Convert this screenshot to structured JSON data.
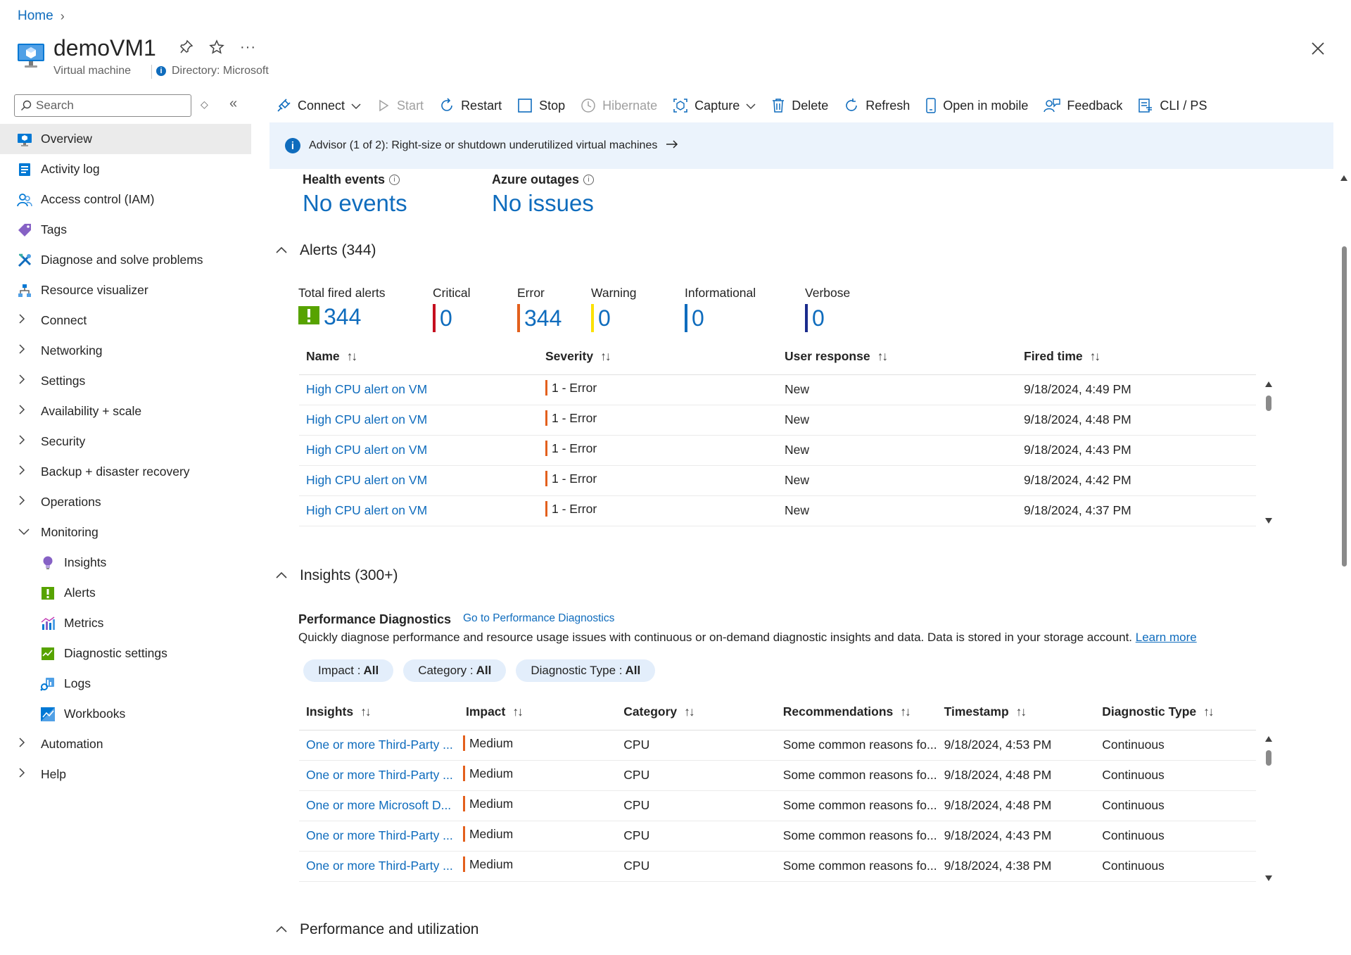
{
  "breadcrumb": {
    "home": "Home"
  },
  "header": {
    "title": "demoVM1",
    "subtitle": "Virtual machine",
    "directory": "Directory: Microsoft"
  },
  "sidebar": {
    "search_placeholder": "Search",
    "items": [
      {
        "label": "Overview",
        "type": "top",
        "icon": "vm-icon",
        "active": true
      },
      {
        "label": "Activity log",
        "type": "top",
        "icon": "activity-log-icon"
      },
      {
        "label": "Access control (IAM)",
        "type": "top",
        "icon": "people-icon"
      },
      {
        "label": "Tags",
        "type": "top",
        "icon": "tag-icon"
      },
      {
        "label": "Diagnose and solve problems",
        "type": "top",
        "icon": "wrench-icon"
      },
      {
        "label": "Resource visualizer",
        "type": "top",
        "icon": "hierarchy-icon"
      },
      {
        "label": "Connect",
        "type": "group"
      },
      {
        "label": "Networking",
        "type": "group"
      },
      {
        "label": "Settings",
        "type": "group"
      },
      {
        "label": "Availability + scale",
        "type": "group"
      },
      {
        "label": "Security",
        "type": "group"
      },
      {
        "label": "Backup + disaster recovery",
        "type": "group"
      },
      {
        "label": "Operations",
        "type": "group"
      },
      {
        "label": "Monitoring",
        "type": "group-open"
      },
      {
        "label": "Insights",
        "type": "child",
        "icon": "lightbulb-icon"
      },
      {
        "label": "Alerts",
        "type": "child",
        "icon": "alert-icon"
      },
      {
        "label": "Metrics",
        "type": "child",
        "icon": "metrics-icon"
      },
      {
        "label": "Diagnostic settings",
        "type": "child",
        "icon": "diagnostic-settings-icon"
      },
      {
        "label": "Logs",
        "type": "child",
        "icon": "logs-icon"
      },
      {
        "label": "Workbooks",
        "type": "child",
        "icon": "workbooks-icon"
      },
      {
        "label": "Automation",
        "type": "group"
      },
      {
        "label": "Help",
        "type": "group"
      }
    ]
  },
  "toolbar": {
    "connect": "Connect",
    "start": "Start",
    "restart": "Restart",
    "stop": "Stop",
    "hibernate": "Hibernate",
    "capture": "Capture",
    "delete": "Delete",
    "refresh": "Refresh",
    "open_mobile": "Open in mobile",
    "feedback": "Feedback",
    "cli": "CLI / PS"
  },
  "advisor": {
    "text": "Advisor (1 of 2): Right-size or shutdown underutilized virtual machines"
  },
  "health": {
    "events_label": "Health events",
    "events_value": "No events",
    "outages_label": "Azure outages",
    "outages_value": "No issues"
  },
  "alerts": {
    "title": "Alerts (344)",
    "stats": [
      {
        "label": "Total fired alerts",
        "value": "344",
        "color": "#57a300"
      },
      {
        "label": "Critical",
        "value": "0",
        "color": "#c50f1f"
      },
      {
        "label": "Error",
        "value": "344",
        "color": "#e3601d"
      },
      {
        "label": "Warning",
        "value": "0",
        "color": "#fce100"
      },
      {
        "label": "Informational",
        "value": "0",
        "color": "#0f6cbd"
      },
      {
        "label": "Verbose",
        "value": "0",
        "color": "#1a2b8c"
      }
    ],
    "columns": [
      "Name",
      "Severity",
      "User response",
      "Fired time"
    ],
    "rows": [
      {
        "name": "High CPU alert on VM",
        "severity": "1 - Error",
        "response": "New",
        "time": "9/18/2024, 4:49 PM"
      },
      {
        "name": "High CPU alert on VM",
        "severity": "1 - Error",
        "response": "New",
        "time": "9/18/2024, 4:48 PM"
      },
      {
        "name": "High CPU alert on VM",
        "severity": "1 - Error",
        "response": "New",
        "time": "9/18/2024, 4:43 PM"
      },
      {
        "name": "High CPU alert on VM",
        "severity": "1 - Error",
        "response": "New",
        "time": "9/18/2024, 4:42 PM"
      },
      {
        "name": "High CPU alert on VM",
        "severity": "1 - Error",
        "response": "New",
        "time": "9/18/2024, 4:37 PM"
      }
    ]
  },
  "insights": {
    "title": "Insights (300+)",
    "pd_title": "Performance Diagnostics",
    "pd_link": "Go to Performance Diagnostics",
    "pd_desc": "Quickly diagnose performance and resource usage issues with continuous or on-demand diagnostic insights and data. Data is stored in your storage account.",
    "learn_more": "Learn more",
    "filters": [
      {
        "label": "Impact :",
        "value": "All"
      },
      {
        "label": "Category :",
        "value": "All"
      },
      {
        "label": "Diagnostic Type :",
        "value": "All"
      }
    ],
    "columns": [
      "Insights",
      "Impact",
      "Category",
      "Recommendations",
      "Timestamp",
      "Diagnostic Type"
    ],
    "rows": [
      {
        "insight": "One or more Third-Party ...",
        "impact": "Medium",
        "category": "CPU",
        "rec": "Some common reasons fo...",
        "ts": "9/18/2024, 4:53 PM",
        "type": "Continuous"
      },
      {
        "insight": "One or more Third-Party ...",
        "impact": "Medium",
        "category": "CPU",
        "rec": "Some common reasons fo...",
        "ts": "9/18/2024, 4:48 PM",
        "type": "Continuous"
      },
      {
        "insight": "One or more Microsoft D...",
        "impact": "Medium",
        "category": "CPU",
        "rec": "Some common reasons fo...",
        "ts": "9/18/2024, 4:48 PM",
        "type": "Continuous"
      },
      {
        "insight": "One or more Third-Party ...",
        "impact": "Medium",
        "category": "CPU",
        "rec": "Some common reasons fo...",
        "ts": "9/18/2024, 4:43 PM",
        "type": "Continuous"
      },
      {
        "insight": "One or more Third-Party ...",
        "impact": "Medium",
        "category": "CPU",
        "rec": "Some common reasons fo...",
        "ts": "9/18/2024, 4:38 PM",
        "type": "Continuous"
      }
    ]
  },
  "performance": {
    "title": "Performance and utilization"
  }
}
